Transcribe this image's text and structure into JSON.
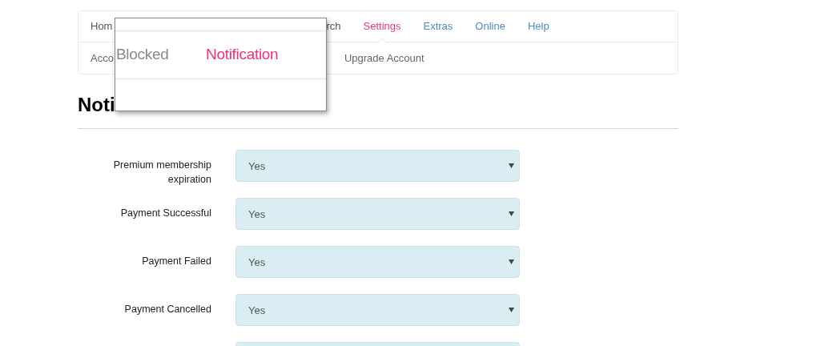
{
  "nav": {
    "primary": [
      {
        "label": "Hom",
        "kind": "plain",
        "selected": false
      },
      {
        "label": "rch",
        "kind": "plain",
        "selected": false
      },
      {
        "label": "Settings",
        "selected": true
      },
      {
        "label": "Extras",
        "kind": "link",
        "selected": false
      },
      {
        "label": "Online",
        "kind": "link",
        "selected": false
      },
      {
        "label": "Help",
        "kind": "link",
        "selected": false
      }
    ],
    "secondary": [
      {
        "label": "Acco"
      },
      {
        "label": "Upgrade Account"
      }
    ]
  },
  "popup": {
    "tabs": [
      {
        "label": "Blocked",
        "selected": false
      },
      {
        "label": "Notification",
        "selected": true
      }
    ]
  },
  "heading": "Noti",
  "settings": [
    {
      "label": "Premium membership expiration",
      "value": "Yes"
    },
    {
      "label": "Payment Successful",
      "value": "Yes"
    },
    {
      "label": "Payment Failed",
      "value": "Yes"
    },
    {
      "label": "Payment Cancelled",
      "value": "Yes"
    }
  ]
}
